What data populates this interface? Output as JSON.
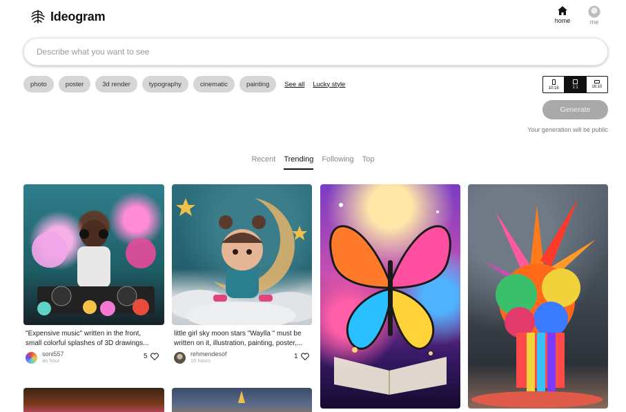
{
  "brand": {
    "name": "Ideogram",
    "logo_icon": "ideogram-logo-icon"
  },
  "nav": {
    "home": {
      "label": "home",
      "icon": "home-icon"
    },
    "me": {
      "label": "me",
      "icon": "avatar"
    }
  },
  "prompt": {
    "placeholder": "Describe what you want to see",
    "value": ""
  },
  "style_chips": [
    "photo",
    "poster",
    "3d render",
    "typography",
    "cinematic",
    "painting"
  ],
  "links": {
    "see_all": "See all",
    "lucky_style": "Lucky style"
  },
  "aspect_ratio": {
    "options": [
      "10:16",
      "1:1",
      "16:10"
    ],
    "selected": "1:1"
  },
  "generate": {
    "label": "Generate",
    "note": "Your generation will be public"
  },
  "feed_tabs": {
    "items": [
      "Recent",
      "Trending",
      "Following",
      "Top"
    ],
    "active": "Trending"
  },
  "cards": [
    {
      "caption_line1": "\"Expensive music\" written in the front,",
      "caption_line2": "small colorful splashes of 3D drawings...",
      "user": "soni557",
      "time": "an hour",
      "likes": "5"
    },
    {
      "caption_line1": "little girl sky moon stars \"Waylla \" must be",
      "caption_line2": "written on it, illustration, painting, poster,...",
      "user": "rehmendesof",
      "time": "16 hours",
      "likes": "1"
    }
  ],
  "colors": {
    "accent": "#111111",
    "chip_bg": "#d6d6d6",
    "generate_disabled": "#a9a9a9"
  }
}
